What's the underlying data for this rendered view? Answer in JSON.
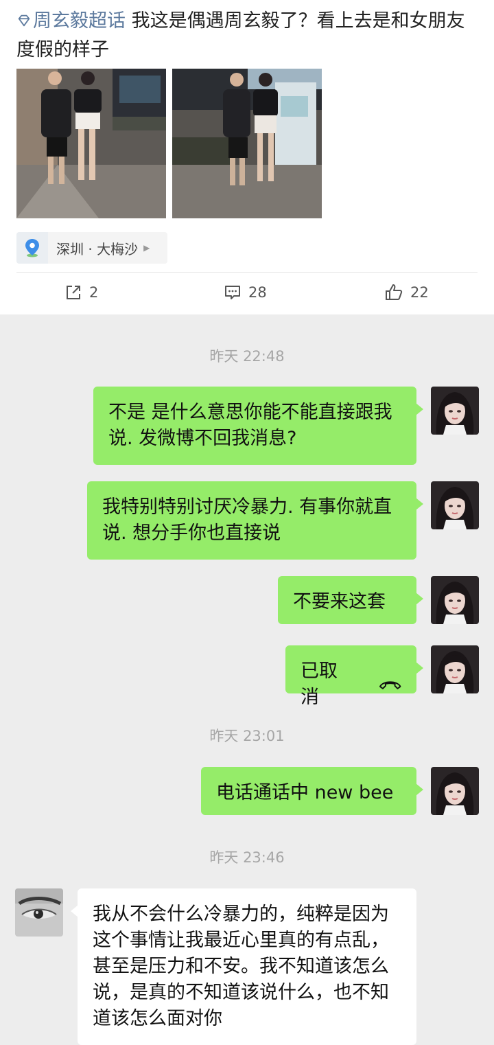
{
  "post": {
    "topic": "周玄毅超话",
    "text": "我这是偶遇周玄毅了？看上去是和女朋友度假的样子",
    "location": "深圳 · 大梅沙",
    "actions": {
      "shares": "2",
      "comments": "28",
      "likes": "22"
    }
  },
  "chat": {
    "timestamps": [
      "昨天 22:48",
      "昨天 23:01",
      "昨天 23:46"
    ],
    "messages": [
      {
        "from": "me",
        "text": "不是 是什么意思你能不能直接跟我说. 发微博不回我消息?"
      },
      {
        "from": "me",
        "text": "我特别特别讨厌冷暴力. 有事你就直说. 想分手你也直接说"
      },
      {
        "from": "me",
        "text": "不要来这套"
      },
      {
        "from": "me",
        "text": "已取消",
        "icon": "call-cancelled-icon"
      },
      {
        "from": "me",
        "text": "电话通话中 new bee"
      },
      {
        "from": "other",
        "text": "我从不会什么冷暴力的，纯粹是因为这个事情让我最近心里真的有点乱，甚至是压力和不安。我不知道该怎么说，是真的不知道该说什么，也不知道该怎么面对你"
      }
    ]
  },
  "colors": {
    "sent_bubble": "#95ec69",
    "received_bubble": "#ffffff",
    "chat_background": "#ededed",
    "topic_link": "#5d7a9e"
  }
}
